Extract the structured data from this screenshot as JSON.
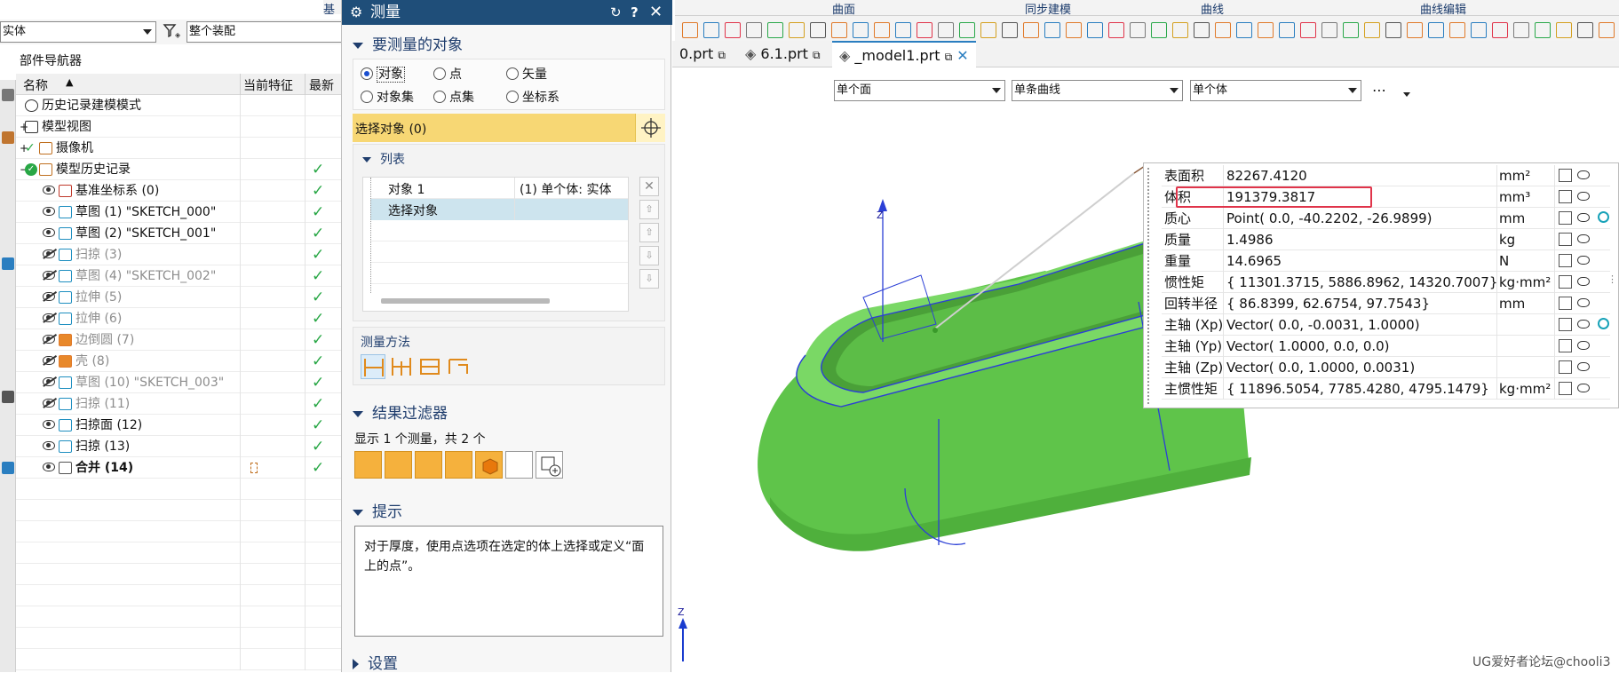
{
  "ribbon": {
    "groups": [
      "基本",
      "曲面",
      "同步建模",
      "曲线",
      "曲线编辑"
    ]
  },
  "filter": {
    "type_value": "实体",
    "scope_value": "整个装配"
  },
  "navigator": {
    "title": "部件导航器",
    "col_name": "名称",
    "col_current": "当前特征",
    "col_latest": "最新",
    "rows": [
      {
        "label": "历史记录建模模式",
        "indent": 0
      },
      {
        "label": "模型视图",
        "indent": 0
      },
      {
        "label": "摄像机",
        "indent": 0
      },
      {
        "label": "模型历史记录",
        "indent": 0
      },
      {
        "label": "基准坐标系 (0)",
        "indent": 1
      },
      {
        "label": "草图 (1) \"SKETCH_000\"",
        "indent": 1
      },
      {
        "label": "草图 (2) \"SKETCH_001\"",
        "indent": 1
      },
      {
        "label": "扫掠 (3)",
        "indent": 1
      },
      {
        "label": "草图 (4) \"SKETCH_002\"",
        "indent": 1
      },
      {
        "label": "拉伸 (5)",
        "indent": 1
      },
      {
        "label": "拉伸 (6)",
        "indent": 1
      },
      {
        "label": "边倒圆 (7)",
        "indent": 1
      },
      {
        "label": "壳 (8)",
        "indent": 1
      },
      {
        "label": "草图 (10) \"SKETCH_003\"",
        "indent": 1
      },
      {
        "label": "扫掠 (11)",
        "indent": 1
      },
      {
        "label": "扫掠面 (12)",
        "indent": 1
      },
      {
        "label": "扫掠 (13)",
        "indent": 1
      },
      {
        "label": "合并 (14)",
        "indent": 1
      }
    ],
    "check_mark": "✓"
  },
  "dialog": {
    "title": "测量",
    "section_objects": "要测量的对象",
    "radios": [
      "对象",
      "点",
      "矢量",
      "对象集",
      "点集",
      "坐标系"
    ],
    "select_label": "选择对象 (0)",
    "list_title": "列表",
    "list_rows": [
      {
        "name": "对象 1",
        "value": "(1) 单个体: 实体"
      },
      {
        "name": "选择对象",
        "value": ""
      }
    ],
    "method_title": "测量方法",
    "section_filter": "结果过滤器",
    "filter_text": "显示 1 个测量，共 2 个",
    "section_hint": "提示",
    "hint_text": "对于厚度，使用点选项在选定的体上选择或定义“面上的点”。",
    "section_settings": "设置"
  },
  "tabs": [
    "0.prt",
    "6.1.prt",
    "_model1.prt"
  ],
  "selection_bar": {
    "face_filter": "单个面",
    "curve_filter": "单条曲线",
    "body_filter": "单个体",
    "more": "⋯"
  },
  "properties": [
    {
      "key": "表面积",
      "value": "82267.4120",
      "unit": "mm²"
    },
    {
      "key": "体积",
      "value": "191379.3817",
      "unit": "mm³"
    },
    {
      "key": "质心",
      "value": "Point( 0.0, -40.2202, -26.9899)",
      "unit": "mm"
    },
    {
      "key": "质量",
      "value": "1.4986",
      "unit": "kg"
    },
    {
      "key": "重量",
      "value": "14.6965",
      "unit": "N"
    },
    {
      "key": "惯性矩",
      "value": "{ 11301.3715, 5886.8962, 14320.7007}",
      "unit": "kg·mm²"
    },
    {
      "key": "回转半径",
      "value": "{ 86.8399, 62.6754, 97.7543}",
      "unit": "mm"
    },
    {
      "key": "主轴 (Xp)",
      "value": "Vector( 0.0, -0.0031, 1.0000)",
      "unit": ""
    },
    {
      "key": "主轴 (Yp)",
      "value": "Vector( 1.0000, 0.0, 0.0)",
      "unit": ""
    },
    {
      "key": "主轴 (Zp)",
      "value": "Vector( 0.0, 1.0000, 0.0031)",
      "unit": ""
    },
    {
      "key": "主惯性矩",
      "value": "{ 11896.5054, 7785.4280, 4795.1479}",
      "unit": "kg·mm²"
    }
  ],
  "axis_labels": {
    "z_model": "Z",
    "z_triad": "Z"
  },
  "watermark": "UG爱好者论坛@chooli3",
  "colors": {
    "title_bar": "#1f4e79",
    "model_green": "#6fd15a",
    "highlight": "#f7d774",
    "checkmark": "#28a745",
    "volume_box": "#e0344a"
  }
}
